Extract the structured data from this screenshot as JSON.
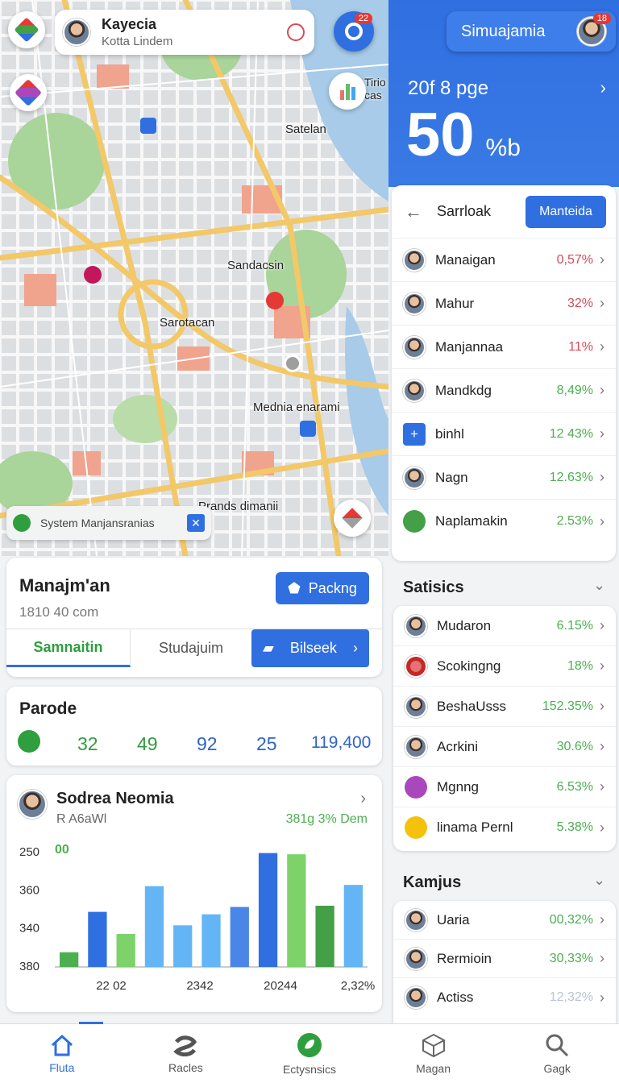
{
  "map": {
    "user": {
      "name": "Kayecia",
      "subtitle": "Kotta Lindem"
    },
    "notif_count": "22",
    "places": [
      {
        "id": "satelan",
        "label": "Satelan"
      },
      {
        "id": "tirio",
        "label": "Tirio cas"
      },
      {
        "id": "sandacsin",
        "label": "Sandacsin"
      },
      {
        "id": "sarotacan",
        "label": "Sarotacan"
      },
      {
        "id": "mednia",
        "label": "Mednia enarami"
      },
      {
        "id": "prands",
        "label": "Prands dimanii"
      }
    ],
    "toast": {
      "text": "System Manjansranias"
    }
  },
  "header": {
    "pill_label": "Simuajamia",
    "avatar_badge": "18",
    "subtitle": "20f 8 pge",
    "big_value": "50",
    "big_unit": "%b"
  },
  "list_panel": {
    "search_label": "Sarrloak",
    "action_label": "Manteida",
    "items": [
      {
        "name": "Manaigan",
        "value": "0,57%",
        "tone": "red"
      },
      {
        "name": "Mahur",
        "value": "32%",
        "tone": "red"
      },
      {
        "name": "Manjannaa",
        "value": "11%",
        "tone": "red"
      },
      {
        "name": "Mandkdg",
        "value": "8,49%",
        "tone": "green"
      },
      {
        "name": "binhl",
        "value": "12 43%",
        "tone": "green"
      },
      {
        "name": "Nagn",
        "value": "12.63%",
        "tone": "green"
      },
      {
        "name": "Naplamakin",
        "value": "2.53%",
        "tone": "green"
      }
    ]
  },
  "statistics": {
    "title": "Satisics",
    "items": [
      {
        "name": "Mudaron",
        "value": "6.15%"
      },
      {
        "name": "Scokingng",
        "value": "18%"
      },
      {
        "name": "BeshaUsss",
        "value": "152.35%"
      },
      {
        "name": "Acrkini",
        "value": "30.6%"
      },
      {
        "name": "Mgnng",
        "value": "6.53%"
      },
      {
        "name": "linama Pernl",
        "value": "5.38%"
      }
    ]
  },
  "kamjus": {
    "title": "Kamjus",
    "items": [
      {
        "name": "Uaria",
        "value": "00,32%"
      },
      {
        "name": "Rermioin",
        "value": "30,33%"
      },
      {
        "name": "Actiss",
        "value": "12,32%"
      }
    ]
  },
  "manage_card": {
    "title": "Manajm'an",
    "subtitle": "1810 40 com",
    "button_label": "Packng",
    "tabs": [
      "Samnaitin",
      "Studajuim",
      "Bilseek"
    ]
  },
  "parode_card": {
    "title": "Parode",
    "values": [
      "32",
      "49",
      "92",
      "25",
      "119,400"
    ]
  },
  "chart_card": {
    "name": "Sodrea Neomia",
    "subtitle": "R A6aWl",
    "highlight": "381g 3% Dem",
    "marker": "00"
  },
  "chart_data": {
    "type": "bar",
    "y_ticks": [
      "250",
      "360",
      "340",
      "380"
    ],
    "x_ticks": [
      "22 02",
      "2342",
      "20244",
      "2,32%"
    ],
    "bars": [
      {
        "value": 0.12,
        "color": "#4caf50"
      },
      {
        "value": 0.45,
        "color": "#2f6fe0"
      },
      {
        "value": 0.27,
        "color": "#7dd36a"
      },
      {
        "value": 0.66,
        "color": "#64b5f6"
      },
      {
        "value": 0.34,
        "color": "#64b5f6"
      },
      {
        "value": 0.43,
        "color": "#64b5f6"
      },
      {
        "value": 0.49,
        "color": "#4a86e8"
      },
      {
        "value": 0.93,
        "color": "#2f6fe0"
      },
      {
        "value": 0.92,
        "color": "#7dd36a"
      },
      {
        "value": 0.5,
        "color": "#43a047"
      },
      {
        "value": 0.67,
        "color": "#64b5f6"
      }
    ]
  },
  "bottom_nav": [
    {
      "label": "Fluta",
      "icon": "home-icon"
    },
    {
      "label": "Racles",
      "icon": "layers-icon"
    },
    {
      "label": "Ectysnsics",
      "icon": "leaf-icon"
    },
    {
      "label": "Magan",
      "icon": "cube-icon"
    },
    {
      "label": "Gagk",
      "icon": "search-icon"
    }
  ]
}
